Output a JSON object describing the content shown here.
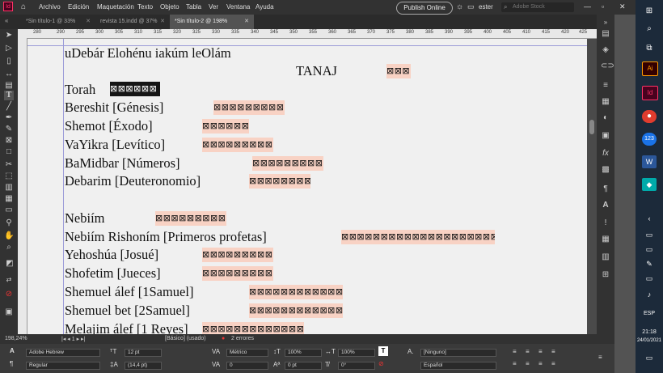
{
  "menubar": {
    "items": [
      "Archivo",
      "Edición",
      "Maquetación",
      "Texto",
      "Objeto",
      "Tabla",
      "Ver",
      "Ventana",
      "Ayuda"
    ],
    "publish_label": "Publish Online",
    "user": "ester",
    "search_placeholder": "Adobe Stock"
  },
  "tabs": [
    "*Sin título-1 @ 33%",
    "revista 15.indd @ 37%",
    "*Sin título-2 @ 198%"
  ],
  "ruler_ticks": [
    "280",
    "290",
    "295",
    "300",
    "305",
    "310",
    "315",
    "320",
    "325",
    "330",
    "335",
    "340",
    "345",
    "350",
    "355",
    "360",
    "365",
    "370",
    "375",
    "380",
    "385",
    "390",
    "395",
    "400",
    "405",
    "410",
    "415",
    "420",
    "425",
    "430"
  ],
  "document": {
    "lines": [
      "uDebár Elohénu  iakúm leOlám",
      "TANAJ",
      "Torah",
      "Bereshit [Génesis]",
      "Shemot [Éxodo]",
      "VaYikra [Levítico]",
      "BaMidbar [Números]",
      "Debarim [Deuteronomio]",
      "Nebiím",
      "Nebiím Rishoním [Primeros profetas]",
      "Yehoshúa [Josué]",
      "Shofetim [Jueces]",
      "Shemuel álef [1Samuel]",
      "Shemuel bet [2Samuel]",
      "Melajim álef [1 Reyes]"
    ],
    "hebrew_glyphs": [
      "⊠⊠⊠",
      "⊠⊠⊠⊠⊠⊠",
      "⊠⊠⊠⊠⊠⊠⊠⊠⊠⊠",
      "⊠⊠⊠⊠⊠⊠",
      "⊠⊠⊠⊠⊠⊠⊠⊠⊠",
      "⊠⊠⊠⊠⊠⊠⊠⊠⊠",
      "⊠⊠⊠⊠⊠⊠⊠⊠",
      "⊠⊠⊠⊠⊠⊠⊠⊠⊠",
      "⊠⊠⊠⊠⊠⊠⊠⊠⊠⊠⊠⊠⊠⊠⊠⊠⊠⊠⊠⊠",
      "⊠⊠⊠⊠⊠⊠⊠⊠⊠",
      "⊠⊠⊠⊠⊠⊠⊠⊠⊠",
      "⊠⊠⊠⊠⊠⊠⊠⊠⊠⊠⊠⊠",
      "⊠⊠⊠⊠⊠⊠⊠⊠⊠⊠⊠⊠",
      "⊠⊠⊠⊠⊠⊠⊠⊠⊠⊠⊠⊠⊠"
    ]
  },
  "status": {
    "zoom": "198,24%",
    "style": "[Básico] (usado)",
    "errors": "2 errores"
  },
  "props": {
    "font": "Adobe Hebrew",
    "font_style": "Regular",
    "size": "12 pt",
    "leading": "(14,4 pt)",
    "kerning": "Métrico",
    "tracking": "0",
    "hscale": "100%",
    "vscale": "100%",
    "baseline": "0 pt",
    "skew": "0°",
    "char_style": "[Ninguno]",
    "language": "Español"
  },
  "taskbar": {
    "lang": "ESP",
    "time": "21:18",
    "date": "24/01/2021",
    "chrome_badge": "123"
  },
  "colors": {
    "highlight": "#f8d2c4",
    "selection": "#151515",
    "ui_dark": "#323232"
  }
}
